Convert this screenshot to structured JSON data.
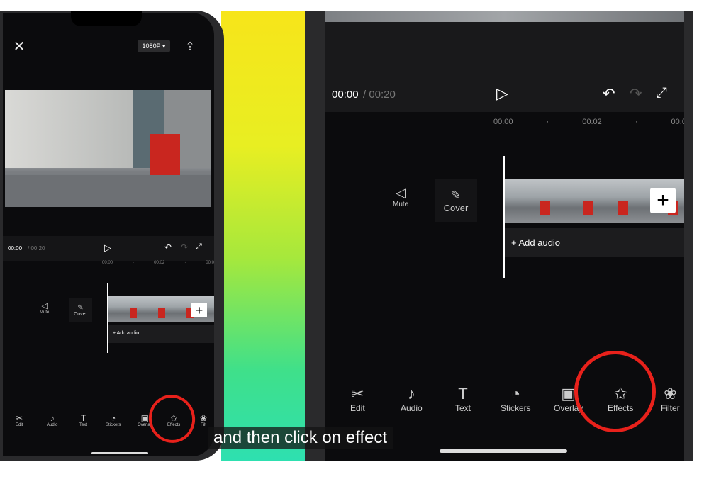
{
  "left_phone": {
    "resolution": "1080P ▾",
    "time_current": "00:00",
    "time_total": "/ 00:20",
    "ruler": [
      "00:00",
      "·",
      "00:02",
      "·",
      "00:0"
    ],
    "mute": "Mute",
    "cover": "Cover",
    "add_audio": "+ Add audio",
    "toolbar": [
      "Edit",
      "Audio",
      "Text",
      "Stickers",
      "Overlay",
      "Effects",
      "Filt"
    ]
  },
  "right_phone": {
    "time_current": "00:00",
    "time_total": "/ 00:20",
    "ruler": [
      "00:00",
      "·",
      "00:02",
      "·",
      "00:0"
    ],
    "mute": "Mute",
    "cover": "Cover",
    "add_audio": "+ Add audio",
    "toolbar": [
      "Edit",
      "Audio",
      "Text",
      "Stickers",
      "Overlay",
      "Effects",
      "Filter"
    ]
  },
  "caption": "and then click on effect",
  "colors": {
    "highlight": "#e8211b",
    "screen": "#0b0b0d"
  }
}
